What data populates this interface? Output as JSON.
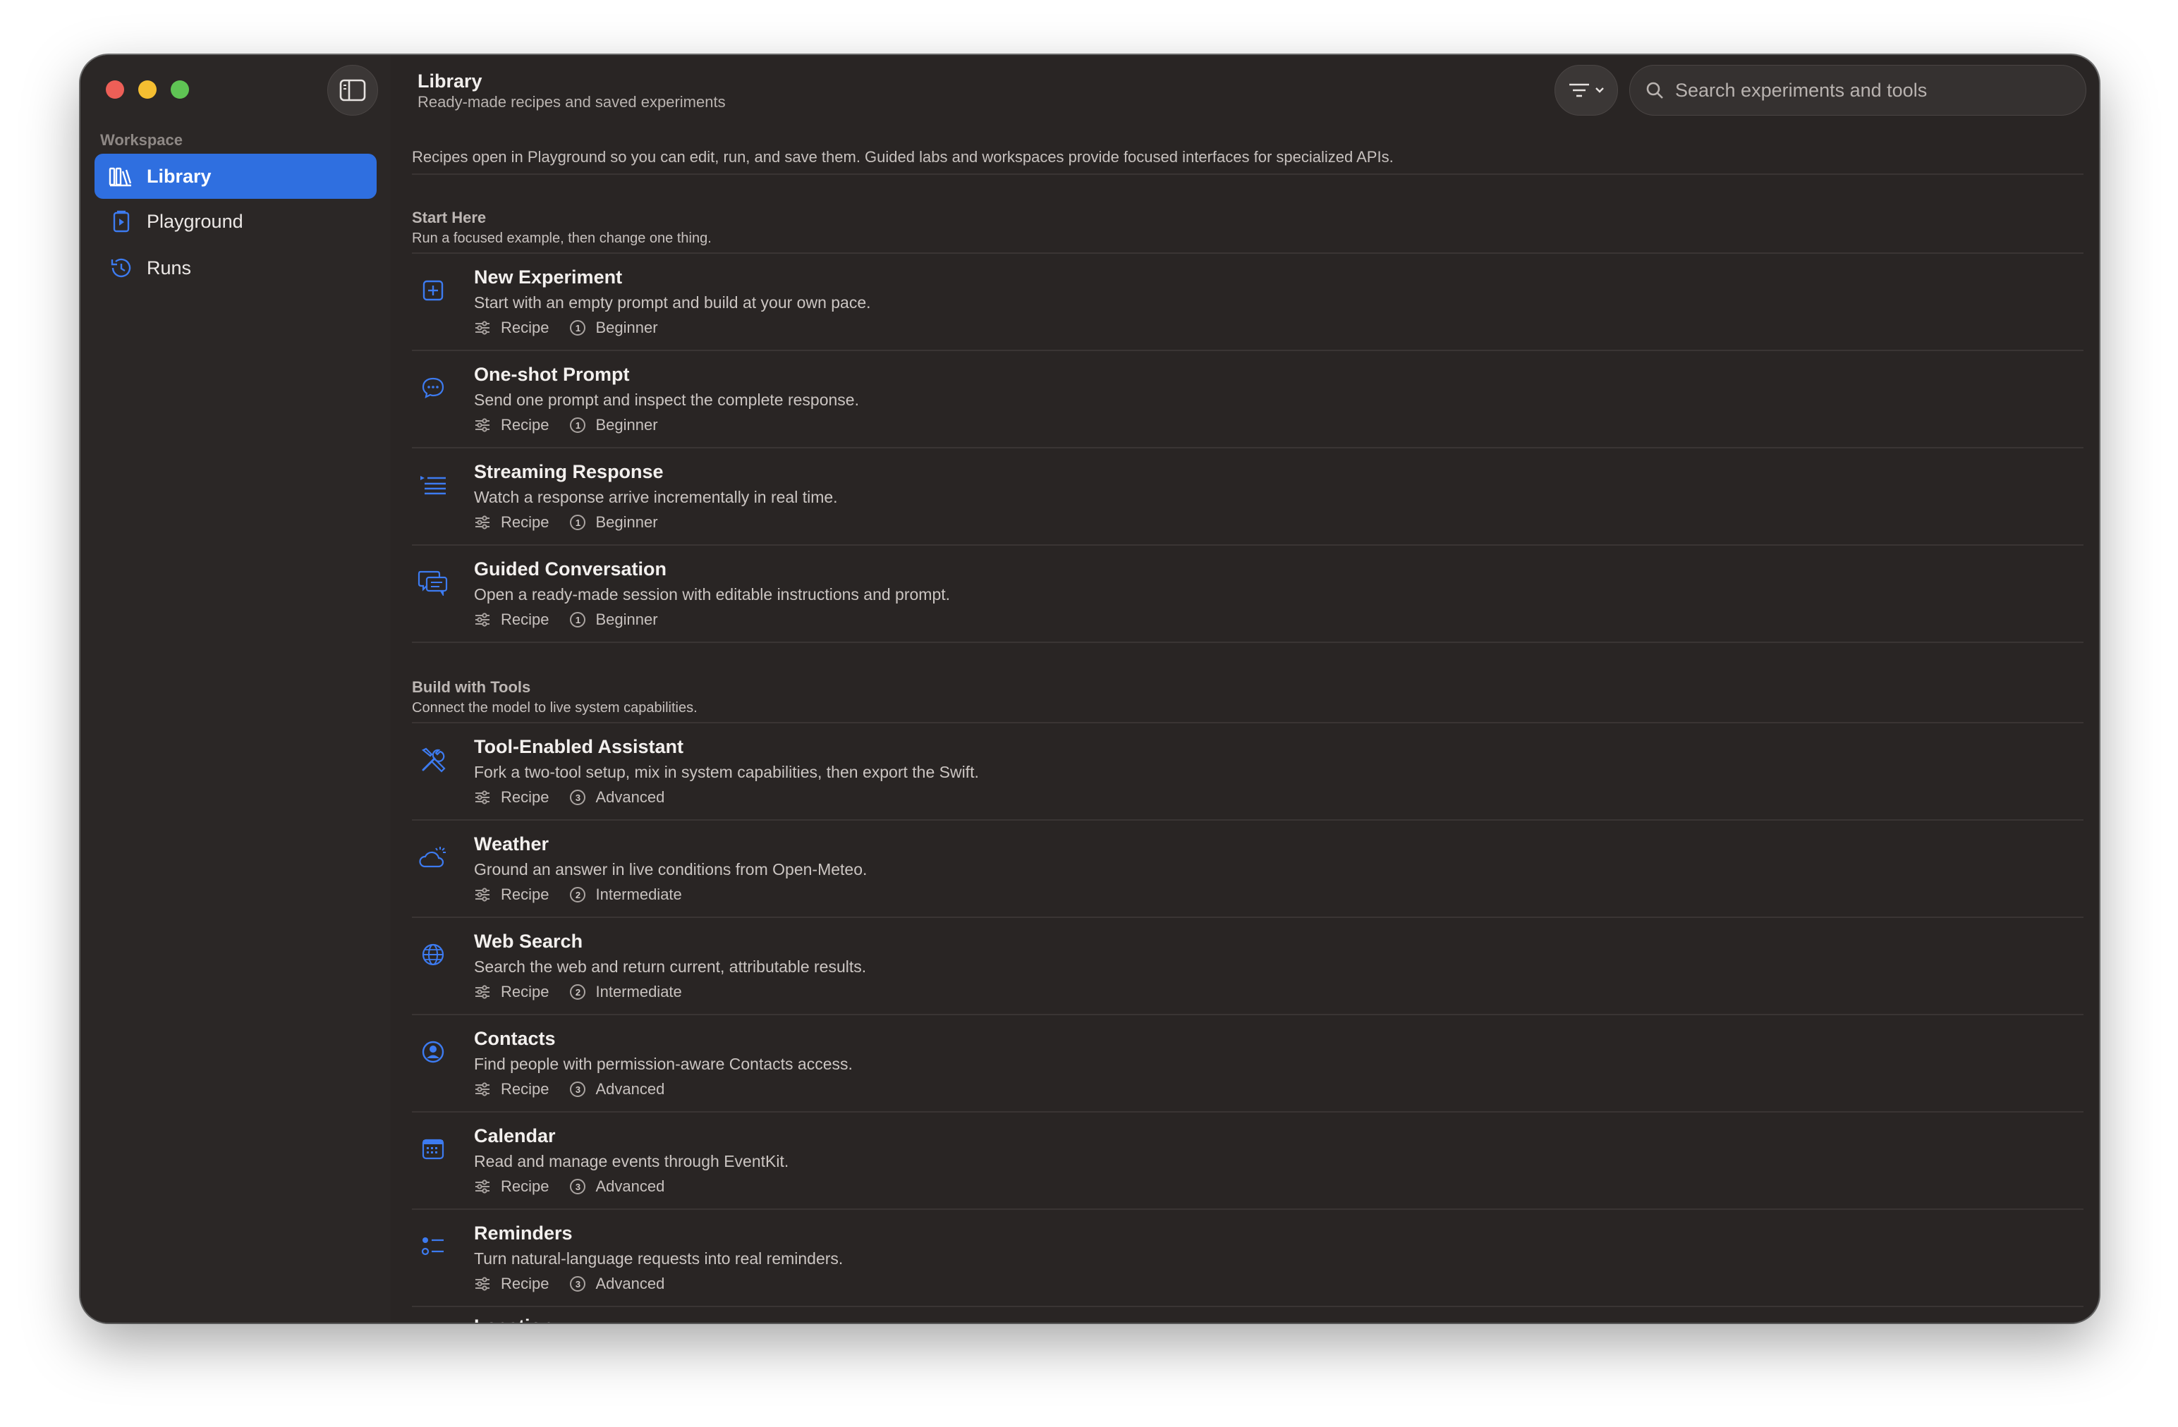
{
  "sidebar": {
    "section_label": "Workspace",
    "items": [
      {
        "label": "Library",
        "icon": "library-icon",
        "active": true
      },
      {
        "label": "Playground",
        "icon": "playground-icon",
        "active": false
      },
      {
        "label": "Runs",
        "icon": "history-icon",
        "active": false
      }
    ]
  },
  "header": {
    "title": "Library",
    "subtitle": "Ready-made recipes and saved experiments"
  },
  "search": {
    "placeholder": "Search experiments and tools"
  },
  "intro": "Recipes open in Playground so you can edit, run, and save them. Guided labs and workspaces provide focused interfaces for specialized APIs.",
  "sections": [
    {
      "title": "Start Here",
      "description": "Run a focused example, then change one thing.",
      "items": [
        {
          "title": "New Experiment",
          "description": "Start with an empty prompt and build at your own pace.",
          "kind": "Recipe",
          "level_number": "1",
          "level": "Beginner",
          "icon": "plus-square-icon"
        },
        {
          "title": "One-shot Prompt",
          "description": "Send one prompt and inspect the complete response.",
          "kind": "Recipe",
          "level_number": "1",
          "level": "Beginner",
          "icon": "speech-bubble-icon"
        },
        {
          "title": "Streaming Response",
          "description": "Watch a response arrive incrementally in real time.",
          "kind": "Recipe",
          "level_number": "1",
          "level": "Beginner",
          "icon": "streaming-lines-icon"
        },
        {
          "title": "Guided Conversation",
          "description": "Open a ready-made session with editable instructions and prompt.",
          "kind": "Recipe",
          "level_number": "1",
          "level": "Beginner",
          "icon": "conversation-bubbles-icon"
        }
      ]
    },
    {
      "title": "Build with Tools",
      "description": "Connect the model to live system capabilities.",
      "items": [
        {
          "title": "Tool-Enabled Assistant",
          "description": "Fork a two-tool setup, mix in system capabilities, then export the Swift.",
          "kind": "Recipe",
          "level_number": "3",
          "level": "Advanced",
          "icon": "tools-icon"
        },
        {
          "title": "Weather",
          "description": "Ground an answer in live conditions from Open-Meteo.",
          "kind": "Recipe",
          "level_number": "2",
          "level": "Intermediate",
          "icon": "cloud-sun-icon"
        },
        {
          "title": "Web Search",
          "description": "Search the web and return current, attributable results.",
          "kind": "Recipe",
          "level_number": "2",
          "level": "Intermediate",
          "icon": "globe-icon"
        },
        {
          "title": "Contacts",
          "description": "Find people with permission-aware Contacts access.",
          "kind": "Recipe",
          "level_number": "3",
          "level": "Advanced",
          "icon": "person-circle-icon"
        },
        {
          "title": "Calendar",
          "description": "Read and manage events through EventKit.",
          "kind": "Recipe",
          "level_number": "3",
          "level": "Advanced",
          "icon": "calendar-icon"
        },
        {
          "title": "Reminders",
          "description": "Turn natural-language requests into real reminders.",
          "kind": "Recipe",
          "level_number": "3",
          "level": "Advanced",
          "icon": "checklist-icon"
        },
        {
          "title": "Location",
          "partial": true
        }
      ]
    }
  ],
  "colors": {
    "accent": "#2f6fe0",
    "icon_blue": "#3d7bf0",
    "window_bg": "#292524"
  }
}
